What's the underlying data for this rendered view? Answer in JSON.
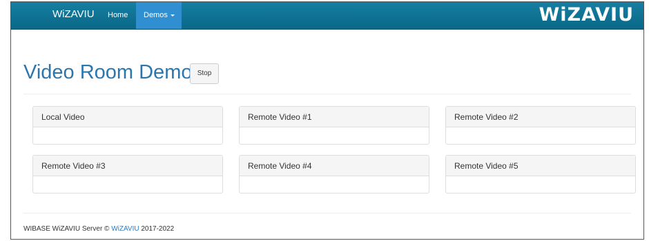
{
  "navbar": {
    "brand": "WiZAVIU",
    "home": "Home",
    "demos": "Demos",
    "logo": "WiZAVIU"
  },
  "page": {
    "title": "Video Room Demo",
    "stop_label": "Stop"
  },
  "panels": [
    {
      "title": "Local Video"
    },
    {
      "title": "Remote Video #1"
    },
    {
      "title": "Remote Video #2"
    },
    {
      "title": "Remote Video #3"
    },
    {
      "title": "Remote Video #4"
    },
    {
      "title": "Remote Video #5"
    }
  ],
  "footer": {
    "prefix": "WIBASE WiZAVIU Server © ",
    "link": "WiZAVIU",
    "suffix": " 2017-2022"
  },
  "colors": {
    "navbar": "#0a6787",
    "active_tab": "#2f8fd0",
    "title": "#2c76ae"
  }
}
